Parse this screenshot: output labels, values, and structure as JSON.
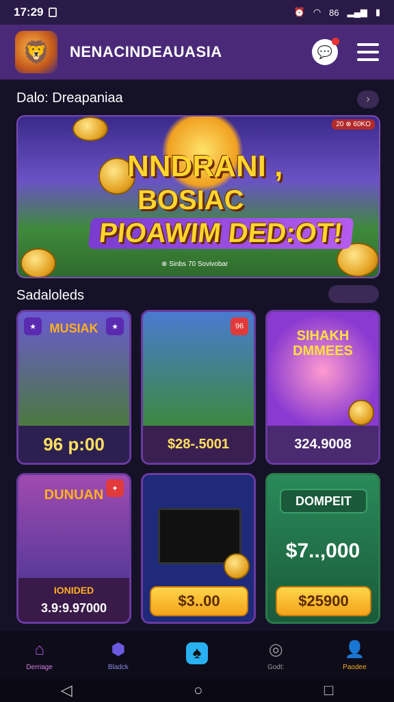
{
  "status": {
    "time": "17:29",
    "net": "86"
  },
  "header": {
    "title": "NENACINDEAUASIA"
  },
  "sections": {
    "featured": "Dalo: Dreapaniaa",
    "selected": "Sadaloleds"
  },
  "banner": {
    "line1": "NNDRANI ,",
    "line2": "BOSIAC",
    "line3": "PIOAWIM DED:OT!",
    "caption": "⊗ Sinbs 70 Sovivobar",
    "corner": "20 ⊗ 60KO"
  },
  "cards": [
    {
      "title": "MUSIAK",
      "price": "96 p:00"
    },
    {
      "price": "$28-.5001"
    },
    {
      "title": "SIHAKH DMMEES",
      "price": "324.9008"
    },
    {
      "title": "DUNUAN",
      "sublabel": "IONIDED",
      "price": "3.9:9.97000"
    },
    {
      "button": "$3..00"
    },
    {
      "title": "DOMPEIT",
      "amount": "$7..,000",
      "button": "$25900"
    }
  ],
  "nav": {
    "home": "Derriage",
    "blocks": "Bladck",
    "center": "",
    "goals": "Godt:",
    "profile": "Paodee"
  },
  "colors": {
    "accent": "#ffd54a",
    "brand": "#4a2a78",
    "active": "#28b0f0"
  }
}
